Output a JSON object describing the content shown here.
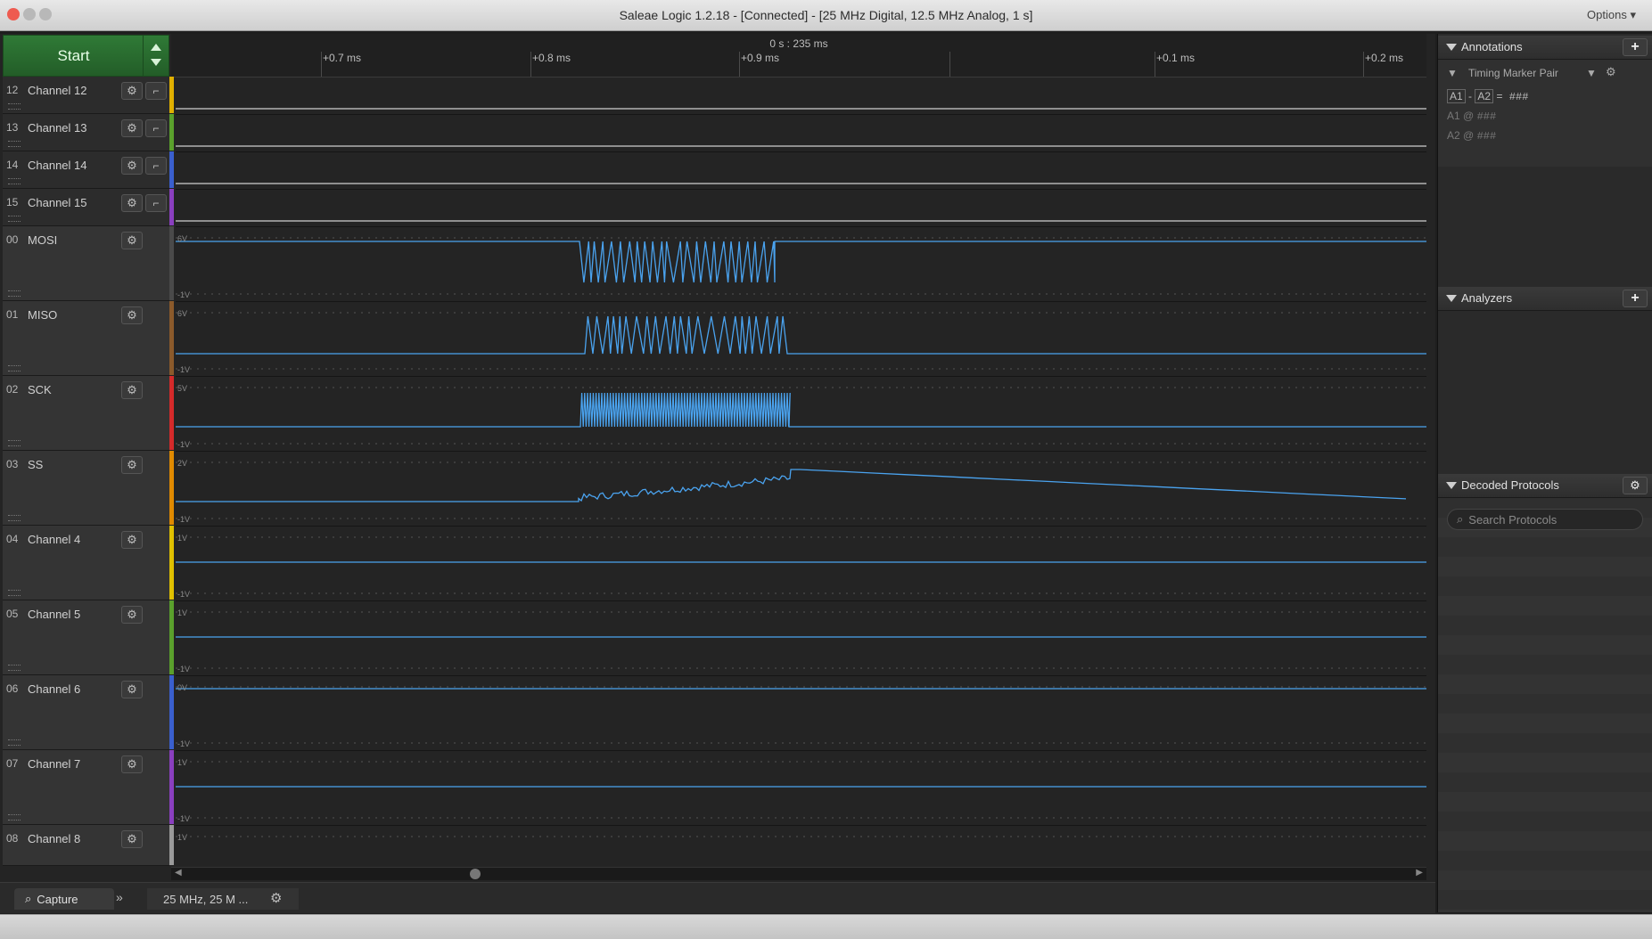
{
  "window": {
    "title": "Saleae Logic 1.2.18 - [Connected] - [25 MHz Digital, 12.5 MHz Analog, 1 s]",
    "options_label": "Options"
  },
  "toolbar": {
    "start_label": "Start"
  },
  "ruler": {
    "center_label": "0 s : 235 ms",
    "ticks": [
      "+0.7 ms",
      "+0.8 ms",
      "+0.9 ms",
      "+0.1 ms",
      "+0.2 ms"
    ]
  },
  "channels": [
    {
      "num": "12",
      "name": "Channel 12",
      "color": "#e0b000",
      "type": "digital"
    },
    {
      "num": "13",
      "name": "Channel 13",
      "color": "#5aa02c",
      "type": "digital"
    },
    {
      "num": "14",
      "name": "Channel 14",
      "color": "#3a5fcd",
      "type": "digital"
    },
    {
      "num": "15",
      "name": "Channel 15",
      "color": "#8a3fbf",
      "type": "digital"
    },
    {
      "num": "00",
      "name": "MOSI",
      "color": "#4a4a4a",
      "type": "analog",
      "vmax": "6V",
      "vmin": "-1V"
    },
    {
      "num": "01",
      "name": "MISO",
      "color": "#8b5a2b",
      "type": "analog",
      "vmax": "6V",
      "vmin": "-1V"
    },
    {
      "num": "02",
      "name": "SCK",
      "color": "#d42a2a",
      "type": "analog",
      "vmax": "5V",
      "vmin": "-1V"
    },
    {
      "num": "03",
      "name": "SS",
      "color": "#e08a00",
      "type": "analog",
      "vmax": "2V",
      "vmin": "-1V"
    },
    {
      "num": "04",
      "name": "Channel 4",
      "color": "#e0c000",
      "type": "analog",
      "vmax": "1V",
      "vmin": "-1V"
    },
    {
      "num": "05",
      "name": "Channel 5",
      "color": "#5aa02c",
      "type": "analog",
      "vmax": "1V",
      "vmin": "-1V"
    },
    {
      "num": "06",
      "name": "Channel 6",
      "color": "#3a5fcd",
      "type": "analog",
      "vmax": "0V",
      "vmin": "-1V"
    },
    {
      "num": "07",
      "name": "Channel 7",
      "color": "#8a3fbf",
      "type": "analog",
      "vmax": "1V",
      "vmin": "-1V"
    },
    {
      "num": "08",
      "name": "Channel 8",
      "color": "#9a9a9a",
      "type": "analog",
      "vmax": "1V",
      "vmin": ""
    }
  ],
  "bottom": {
    "capture_label": "Capture",
    "rate_label": "25 MHz, 25 M ..."
  },
  "annotations": {
    "title": "Annotations",
    "timing_marker_label": "Timing Marker Pair",
    "a1": "A1",
    "a2": "A2",
    "diff_value": "= ###",
    "a1_row_at": "@",
    "a1_row_value": "###",
    "a2_row_at": "@",
    "a2_row_value": "###",
    "dash": "-"
  },
  "analyzers": {
    "title": "Analyzers"
  },
  "decoded": {
    "title": "Decoded Protocols",
    "search_placeholder": "Search Protocols"
  },
  "colors": {
    "signal": "#4aa3ef",
    "start_green": "#2f7a36"
  }
}
